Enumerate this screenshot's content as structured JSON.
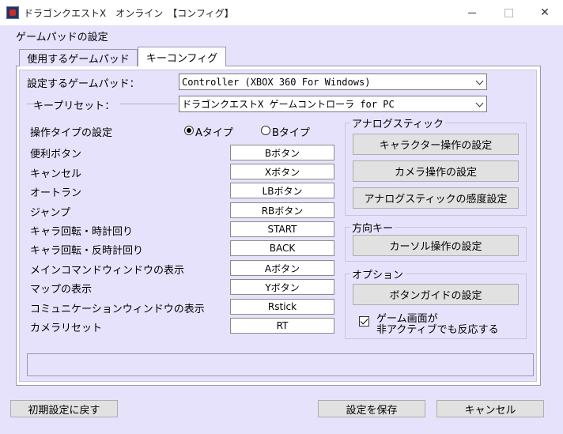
{
  "window": {
    "title": "ドラゴンクエストX　オンライン　【コンフィグ】",
    "min_label": "—",
    "max_label": "☐",
    "close_label": "✕"
  },
  "group_label": "ゲームパッドの設定",
  "tabs": [
    {
      "label": "使用するゲームパッド"
    },
    {
      "label": "キーコンフィグ",
      "active": true
    }
  ],
  "gamepad": {
    "label": "設定するゲームパッド：",
    "value": "Controller (XBOX 360 For Windows)"
  },
  "preset": {
    "label": "キープリセット：",
    "value": "ドラゴンクエストX ゲームコントローラ for PC"
  },
  "operation_type": {
    "label": "操作タイプの設定",
    "options": [
      {
        "label": "Aタイプ",
        "selected": true
      },
      {
        "label": "Bタイプ",
        "selected": false
      }
    ]
  },
  "mappings": [
    {
      "action": "便利ボタン",
      "key": "Bボタン"
    },
    {
      "action": "キャンセル",
      "key": "Xボタン"
    },
    {
      "action": "オートラン",
      "key": "LBボタン"
    },
    {
      "action": "ジャンプ",
      "key": "RBボタン"
    },
    {
      "action": "キャラ回転・時計回り",
      "key": "START"
    },
    {
      "action": "キャラ回転・反時計回り",
      "key": "BACK"
    },
    {
      "action": "メインコマンドウィンドウの表示",
      "key": "Aボタン"
    },
    {
      "action": "マップの表示",
      "key": "Yボタン"
    },
    {
      "action": "コミュニケーションウィンドウの表示",
      "key": "Rstick"
    },
    {
      "action": "カメラリセット",
      "key": "RT"
    }
  ],
  "analog": {
    "title": "アナログスティック",
    "buttons": [
      "キャラクター操作の設定",
      "カメラ操作の設定",
      "アナログスティックの感度設定"
    ]
  },
  "direction": {
    "title": "方向キー",
    "button": "カーソル操作の設定"
  },
  "options": {
    "title": "オプション",
    "button": "ボタンガイドの設定",
    "checkbox_line1": "ゲーム画面が",
    "checkbox_line2": "非アクティブでも反応する",
    "checked": true
  },
  "footer": {
    "reset": "初期設定に戻す",
    "save": "設定を保存",
    "cancel": "キャンセル"
  },
  "colors": {
    "background": "#e7e2fb",
    "panel": "#ffffff",
    "button": "#e1e1e1"
  }
}
